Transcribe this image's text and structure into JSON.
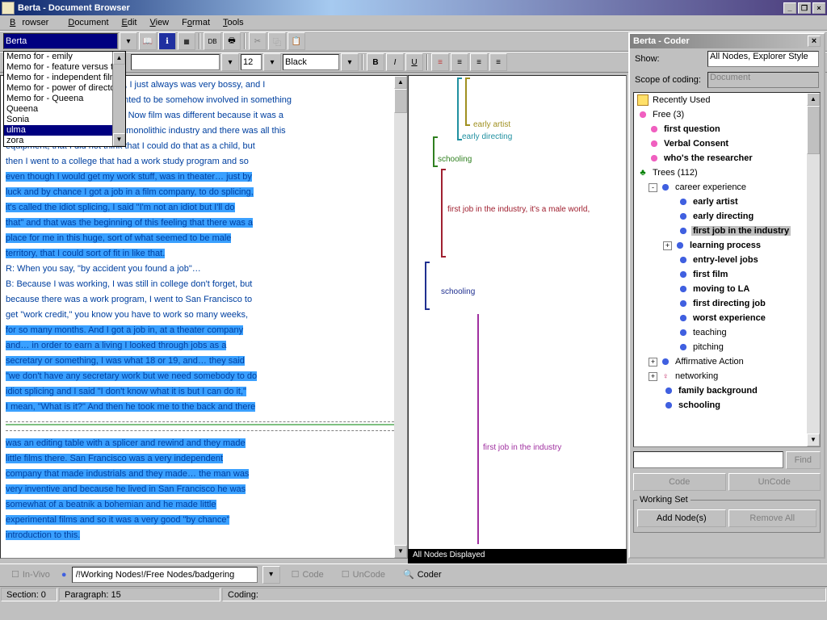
{
  "window": {
    "title": "Berta - Document Browser"
  },
  "menus": [
    "Browser",
    "Document",
    "Edit",
    "View",
    "Format",
    "Tools"
  ],
  "doc_selector": {
    "value": "Berta",
    "options": [
      "Memo for - emily",
      "Memo for - feature versus te",
      "Memo for - independent film",
      "Memo for - power of director",
      "Memo for - Queena",
      "Queena",
      "Sonia",
      "ulma",
      "zora"
    ],
    "selected": "ulma"
  },
  "font_toolbar": {
    "size": "12",
    "color": "Black"
  },
  "document": {
    "p1_pre": "w, I just always was very bossy, and I",
    "p2_pre": "anted to be somehow involved in something",
    "p3_pre": "c.  Now film was different because it was a",
    "p4_pre": "a monolithic industry and there was all this",
    "p5": "equipment, that I did not think that I could do that as a child, but",
    "p6": "then I went to a college that had a work study program and so",
    "hl1": "even though I would get my work stuff, was in theater… just by",
    "hl2": "luck and by chance I got a job in a film company, to do splicing,",
    "hl3": "it's called the idiot splicing, I said \"I'm not an idiot but I'll do",
    "hl4": "that\" and that was the beginning of this feeling that there was a",
    "hl5": "place for me in this huge, sort of what seemed to be male",
    "hl6": "territory, that I could sort of fit in like that.",
    "p7": "R:   When you say, \"by accident you found a job\"…",
    "p8": "B:   Because I was working, I was still in college don't forget, but",
    "p9": "because there was a work program, I went to San Francisco to",
    "p10": "get \"work credit,\" you know you have to work so many weeks,",
    "hl7": "for so many months.  And I got a job in, at a theater company",
    "hl8": "and…  in order to earn a living I looked through jobs as a",
    "hl9": "secretary or something, I was what 18 or 19, and…  they said",
    "hl10": "\"we don't have any secretary work but we need somebody to do",
    "hl11": "idiot splicing and I said \"I don't know what it is but I can do it,\"",
    "hl12": "I mean, \"What is it?\"  And then he took me to the back and there",
    "hl13": "was an editing table with a splicer and rewind and they made",
    "hl14": "little films there.  San Francisco was a very independent",
    "hl15": "company that made industrials and they made…  the man was",
    "hl16": "very inventive and because he lived in San Francisco he was",
    "hl17": "somewhat of a beatnik a bohemian and he made little",
    "hl18": "experimental films and so it was a very good \"by chance\"",
    "hl19": "introduction to this."
  },
  "stripes": {
    "early_artist": "early artist",
    "early_directing": "early directing",
    "schooling": "schooling",
    "first_job_male": "first job in the industry, it's a male world,",
    "first_job": "first job in the industry"
  },
  "status_strip": "All Nodes Displayed",
  "coder": {
    "title": "Berta - Coder",
    "show_label": "Show:",
    "show_value": "All Nodes, Explorer Style",
    "scope_label": "Scope of coding:",
    "scope_value": "Document",
    "recently_used": "Recently Used",
    "free_label": "Free (3)",
    "free_nodes": [
      "first question",
      "Verbal Consent",
      "who's the researcher"
    ],
    "trees_label": "Trees (112)",
    "career": "career experience",
    "career_children": [
      "early artist",
      "early directing",
      "first job in the industry",
      "learning process",
      "entry-level jobs",
      "first film",
      "moving to LA",
      "first directing job",
      "worst experience",
      "teaching",
      "pitching"
    ],
    "career_selected": "first job in the industry",
    "other_trees": [
      "Affirmative Action",
      "networking",
      "family background",
      "schooling"
    ],
    "find": "Find",
    "code": "Code",
    "uncode": "UnCode",
    "working_set": "Working Set",
    "add_nodes": "Add Node(s)",
    "remove_all": "Remove All"
  },
  "bottom": {
    "in_vivo": "In-Vivo",
    "path": "/!Working Nodes!/Free Nodes/badgering",
    "code": "Code",
    "uncode": "UnCode",
    "coder": "Coder"
  },
  "status": {
    "section": "Section:  0",
    "paragraph": "Paragraph:  15",
    "coding": "Coding:"
  }
}
